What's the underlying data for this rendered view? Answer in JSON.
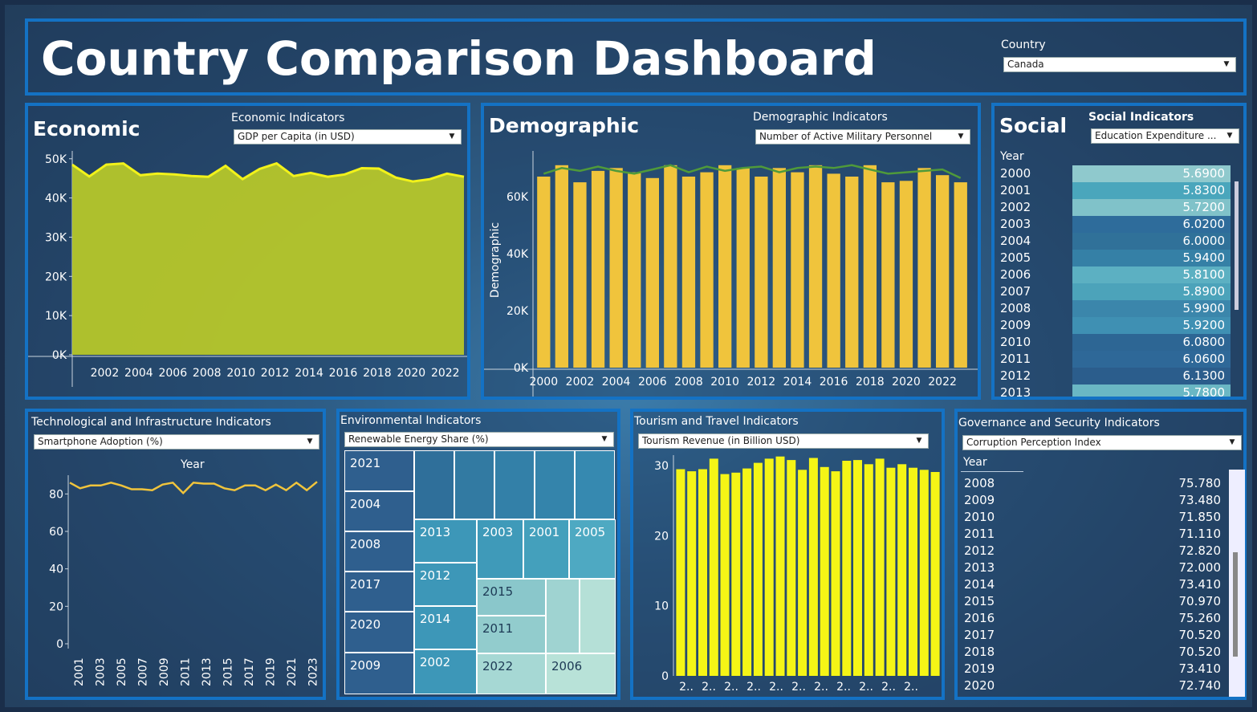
{
  "header": {
    "title": "Country Comparison Dashboard",
    "country_label": "Country",
    "country_value": "Canada"
  },
  "economic": {
    "title": "Economic",
    "selector_label": "Economic Indicators",
    "selector_value": "GDP per Capita (in USD)",
    "colors": {
      "fill": "#b6c72a",
      "line": "#f2f21a"
    }
  },
  "demographic": {
    "title": "Demographic",
    "selector_label": "Demographic Indicators",
    "selector_value": "Number of Active Military Personnel",
    "ylabel": "Demographic",
    "colors": {
      "bar": "#f0c43c",
      "line": "#4f9a3a"
    }
  },
  "social": {
    "title": "Social",
    "selector_label": "Social Indicators",
    "selector_value": "Education Expenditure ...",
    "column_header": "Year",
    "rows": [
      {
        "year": "2000",
        "value": "5.6900"
      },
      {
        "year": "2001",
        "value": "5.8300"
      },
      {
        "year": "2002",
        "value": "5.7200"
      },
      {
        "year": "2003",
        "value": "6.0200"
      },
      {
        "year": "2004",
        "value": "6.0000"
      },
      {
        "year": "2005",
        "value": "5.9400"
      },
      {
        "year": "2006",
        "value": "5.8100"
      },
      {
        "year": "2007",
        "value": "5.8900"
      },
      {
        "year": "2008",
        "value": "5.9900"
      },
      {
        "year": "2009",
        "value": "5.9200"
      },
      {
        "year": "2010",
        "value": "6.0800"
      },
      {
        "year": "2011",
        "value": "6.0600"
      },
      {
        "year": "2012",
        "value": "6.1300"
      },
      {
        "year": "2013",
        "value": "5.7800"
      }
    ]
  },
  "tech": {
    "title": "Technological and Infrastructure Indicators",
    "selector_value": "Smartphone Adoption (%)",
    "chart_title": "Year",
    "colors": {
      "line": "#f0c43c"
    }
  },
  "environment": {
    "title": "Environmental Indicators",
    "selector_value": "Renewable Energy Share (%)",
    "cells": [
      {
        "label": "2021",
        "shade": "#2f5f8e"
      },
      {
        "label": "2004",
        "shade": "#2f5f8e"
      },
      {
        "label": "2008",
        "shade": "#2f5f8e"
      },
      {
        "label": "2017",
        "shade": "#2f5f8e"
      },
      {
        "label": "2020",
        "shade": "#2f5f8e"
      },
      {
        "label": "2009",
        "shade": "#2f5f8e"
      },
      {
        "label": "",
        "shade": "#2f6f9a"
      },
      {
        "label": "",
        "shade": "#327aa2"
      },
      {
        "label": "",
        "shade": "#3380a8"
      },
      {
        "label": "",
        "shade": "#3484ab"
      },
      {
        "label": "",
        "shade": "#3689b0"
      },
      {
        "label": "2013",
        "shade": "#3d97b8"
      },
      {
        "label": "2003",
        "shade": "#3f9ab9"
      },
      {
        "label": "2001",
        "shade": "#44a0bc"
      },
      {
        "label": "2005",
        "shade": "#4ea9c2"
      },
      {
        "label": "2012",
        "shade": "#3d97b8"
      },
      {
        "label": "2015",
        "shade": "#8ac7cb"
      },
      {
        "label": "",
        "shade": "#9fd3d1"
      },
      {
        "label": "",
        "shade": "#b5e0d7"
      },
      {
        "label": "2014",
        "shade": "#3d97b8"
      },
      {
        "label": "2011",
        "shade": "#92cccd"
      },
      {
        "label": "2002",
        "shade": "#3d97b8"
      },
      {
        "label": "2022",
        "shade": "#a6d8d4"
      },
      {
        "label": "2006",
        "shade": "#b8e2d8"
      }
    ]
  },
  "tourism": {
    "title": "Tourism and Travel Indicators",
    "selector_value": "Tourism Revenue (in Billion USD)",
    "tick_label": "2..",
    "colors": {
      "bar": "#f5f516"
    }
  },
  "governance": {
    "title": "Governance and Security Indicators",
    "selector_value": "Corruption Perception Index",
    "column_header": "Year",
    "rows": [
      {
        "year": "2008",
        "value": "75.780"
      },
      {
        "year": "2009",
        "value": "73.480"
      },
      {
        "year": "2010",
        "value": "71.850"
      },
      {
        "year": "2011",
        "value": "71.110"
      },
      {
        "year": "2012",
        "value": "72.820"
      },
      {
        "year": "2013",
        "value": "72.000"
      },
      {
        "year": "2014",
        "value": "73.410"
      },
      {
        "year": "2015",
        "value": "70.970"
      },
      {
        "year": "2016",
        "value": "75.260"
      },
      {
        "year": "2017",
        "value": "70.520"
      },
      {
        "year": "2018",
        "value": "70.520"
      },
      {
        "year": "2019",
        "value": "73.410"
      },
      {
        "year": "2020",
        "value": "72.740"
      }
    ]
  },
  "chart_data": [
    {
      "type": "area",
      "x": [
        2000,
        2001,
        2002,
        2003,
        2004,
        2005,
        2006,
        2007,
        2008,
        2009,
        2010,
        2011,
        2012,
        2013,
        2014,
        2015,
        2016,
        2017,
        2018,
        2019,
        2020,
        2021,
        2022,
        2023
      ],
      "values": [
        48500,
        45500,
        48500,
        48800,
        45800,
        46200,
        46000,
        45600,
        45400,
        48200,
        44800,
        47400,
        48800,
        45600,
        46400,
        45400,
        46000,
        47600,
        47500,
        45200,
        44200,
        44800,
        46200,
        45400
      ],
      "ylim": [
        0,
        52000
      ],
      "yticks": [
        "0K",
        "10K",
        "20K",
        "30K",
        "40K",
        "50K"
      ],
      "xticks": [
        "2002",
        "2004",
        "2006",
        "2008",
        "2010",
        "2012",
        "2014",
        "2016",
        "2018",
        "2020",
        "2022"
      ]
    },
    {
      "type": "bar",
      "x": [
        2000,
        2001,
        2002,
        2003,
        2004,
        2005,
        2006,
        2007,
        2008,
        2009,
        2010,
        2011,
        2012,
        2013,
        2014,
        2015,
        2016,
        2017,
        2018,
        2019,
        2020,
        2021,
        2022,
        2023
      ],
      "values": [
        67000,
        71000,
        65000,
        69000,
        70000,
        68500,
        66500,
        71000,
        67000,
        68500,
        71000,
        70000,
        67000,
        70000,
        68500,
        71000,
        68000,
        67000,
        71000,
        65000,
        65500,
        70000,
        67500,
        65000
      ],
      "line": [
        68000,
        70000,
        69000,
        70500,
        69000,
        68000,
        69500,
        71000,
        68500,
        70500,
        69000,
        70000,
        70500,
        68500,
        70000,
        70500,
        70000,
        71000,
        69500,
        68000,
        68500,
        69000,
        69500,
        66500
      ],
      "ylim": [
        0,
        76000
      ],
      "yticks": [
        "0K",
        "20K",
        "40K",
        "60K"
      ],
      "xticks": [
        "2000",
        "2002",
        "2004",
        "2006",
        "2008",
        "2010",
        "2012",
        "2014",
        "2016",
        "2018",
        "2020",
        "2022"
      ]
    },
    {
      "type": "line",
      "x": [
        2000,
        2001,
        2002,
        2003,
        2004,
        2005,
        2006,
        2007,
        2008,
        2009,
        2010,
        2011,
        2012,
        2013,
        2014,
        2015,
        2016,
        2017,
        2018,
        2019,
        2020,
        2021,
        2022,
        2023
      ],
      "values": [
        86,
        83,
        84.5,
        84.5,
        86,
        84.5,
        82.5,
        82.5,
        82,
        85,
        86,
        80.5,
        86,
        85.5,
        85.5,
        83,
        82,
        84.5,
        84.5,
        82,
        85,
        82,
        86,
        82,
        86.5
      ],
      "ylim": [
        0,
        90
      ],
      "yticks": [
        "0",
        "20",
        "40",
        "60",
        "80"
      ],
      "xticks": [
        "2001",
        "2003",
        "2005",
        "2007",
        "2009",
        "2011",
        "2013",
        "2015",
        "2017",
        "2019",
        "2021",
        "2023"
      ]
    },
    {
      "type": "bar",
      "x": [
        2000,
        2001,
        2002,
        2003,
        2004,
        2005,
        2006,
        2007,
        2008,
        2009,
        2010,
        2011,
        2012,
        2013,
        2014,
        2015,
        2016,
        2017,
        2018,
        2019,
        2020,
        2021,
        2022,
        2023
      ],
      "values": [
        29.5,
        29.2,
        29.5,
        31,
        28.8,
        29,
        29.6,
        30.4,
        31,
        31.3,
        30.8,
        29.4,
        31.1,
        29.8,
        29.2,
        30.7,
        30.8,
        30.2,
        31,
        29.7,
        30.2,
        29.7,
        29.4,
        29.1
      ],
      "ylim": [
        0,
        31.5
      ],
      "yticks": [
        "0",
        "10",
        "20",
        "30"
      ]
    }
  ]
}
